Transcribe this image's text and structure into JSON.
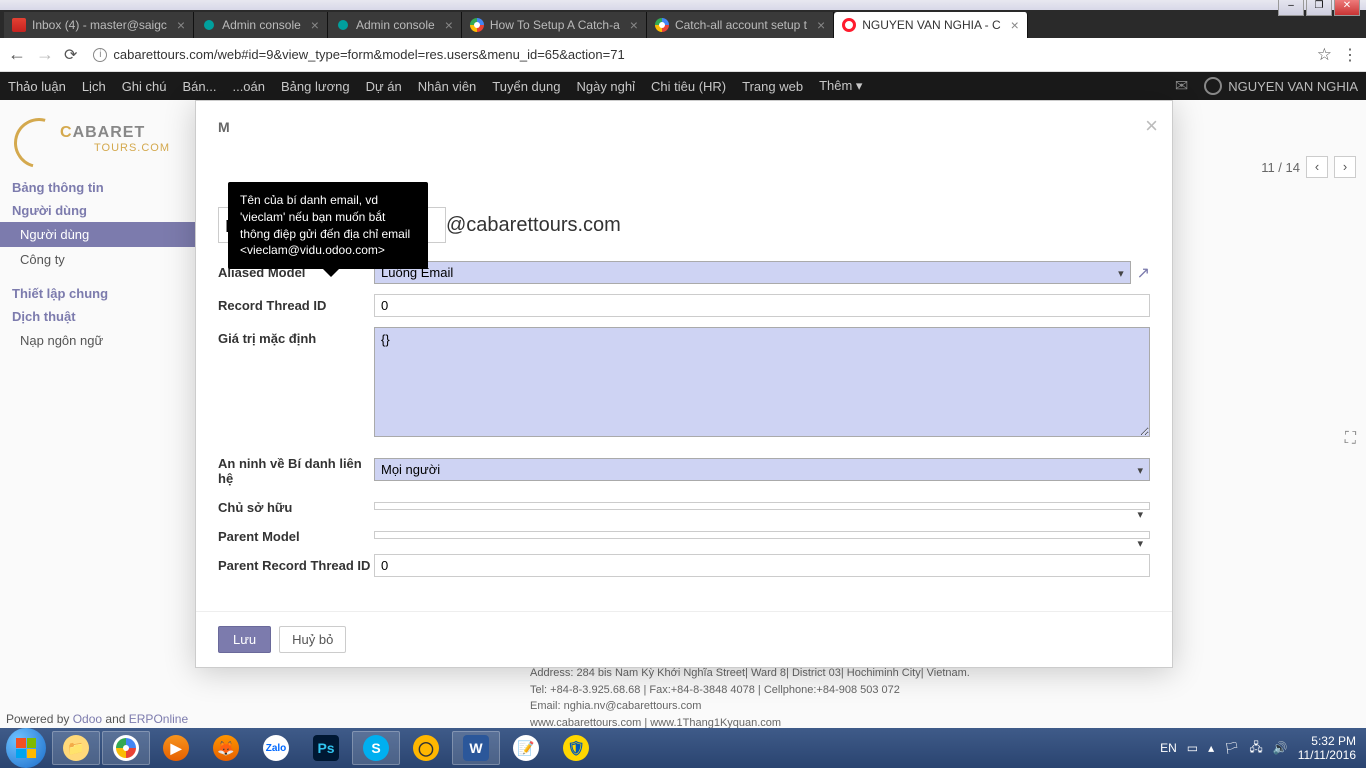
{
  "window_controls": {
    "min": "–",
    "max": "❐",
    "close": "✕"
  },
  "tabs": [
    {
      "label": "Inbox (4) - master@saigc",
      "active": false,
      "icon": "gmail"
    },
    {
      "label": "Admin console",
      "active": false,
      "icon": "odoo"
    },
    {
      "label": "Admin console",
      "active": false,
      "icon": "odoo"
    },
    {
      "label": "How To Setup A Catch-a",
      "active": false,
      "icon": "google"
    },
    {
      "label": "Catch-all account setup t",
      "active": false,
      "icon": "google"
    },
    {
      "label": "NGUYEN VAN NGHIA - C",
      "active": true,
      "icon": "opera"
    }
  ],
  "url": "cabarettours.com/web#id=9&view_type=form&model=res.users&menu_id=65&action=71",
  "app_menu": [
    "Thảo luận",
    "Lịch",
    "Ghi chú",
    "Bán...",
    "...oán",
    "Bảng lương",
    "Dự án",
    "Nhân viên",
    "Tuyển dụng",
    "Ngày nghỉ",
    "Chi tiêu (HR)",
    "Trang web",
    "Thêm ▾"
  ],
  "user_name": "NGUYEN VAN NGHIA",
  "logo": {
    "main": "ABARET",
    "sub": "TOURS.COM",
    "c": "C"
  },
  "sidebar": {
    "group1_header": "Bảng thông tin",
    "group2_header": "Người dùng",
    "group2_items": [
      "Người dùng",
      "Công ty"
    ],
    "group3_header": "Thiết lập chung",
    "group4_header": "Dịch thuật",
    "group4_items": [
      "Nạp ngôn ngữ"
    ]
  },
  "powered": {
    "prefix": "Powered by ",
    "odoo": "Odoo",
    "and": " and ",
    "erp": "ERPOnline"
  },
  "pager": {
    "text": "11 / 14",
    "prev": "‹",
    "next": "›"
  },
  "modal": {
    "title_prefix": "M",
    "alias_value": "nghia.nv",
    "alias_domain": "@cabarettours.com",
    "tooltip": "Tên của bí danh email, vd 'vieclam' nếu bạn muốn bắt thông điệp gửi đến địa chỉ email <vieclam@vidu.odoo.com>",
    "fields": {
      "aliased_model": {
        "label": "Aliased Model",
        "value": "Luồng Email"
      },
      "record_thread_id": {
        "label": "Record Thread ID",
        "value": "0"
      },
      "default_values": {
        "label": "Giá trị mặc định",
        "value": "{}"
      },
      "security": {
        "label": "An ninh về Bí danh liên hệ",
        "value": "Mọi người"
      },
      "owner": {
        "label": "Chủ sở hữu",
        "value": ""
      },
      "parent_model": {
        "label": "Parent Model",
        "value": ""
      },
      "parent_thread_id": {
        "label": "Parent Record Thread ID",
        "value": "0"
      }
    },
    "buttons": {
      "save": "Lưu",
      "cancel": "Huỷ bỏ"
    },
    "close": "×"
  },
  "behind": {
    "addr": "Address: 284 bis Nam Kỳ Khởi Nghĩa Street| Ward 8| District 03| Hochiminh City| Vietnam.",
    "tel": "Tel: +84-8-3.925.68.68 | Fax:+84-8-3848 4078 | Cellphone:+84-908 503 072",
    "email": "Email: nghia.nv@cabarettours.com",
    "web": "www.cabarettours.com | www.1Thang1Kyquan.com"
  },
  "tray": {
    "lang": "EN",
    "ime": "▭",
    "time": "5:32 PM",
    "date": "11/11/2016"
  }
}
